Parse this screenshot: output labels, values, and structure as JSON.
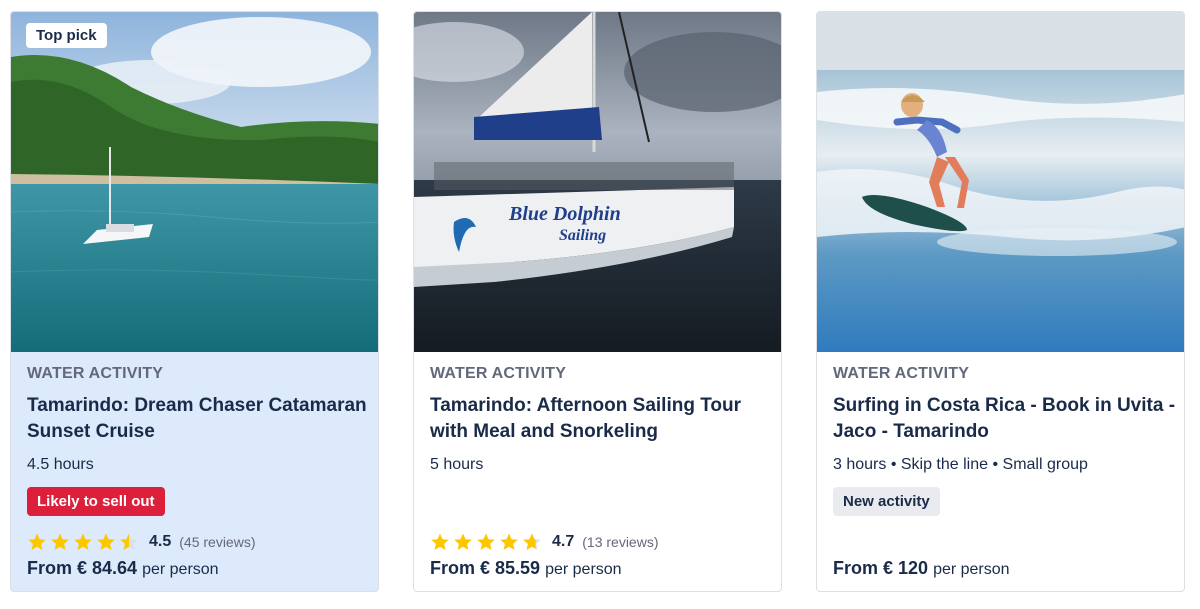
{
  "cards": [
    {
      "badge": "Top pick",
      "category": "WATER ACTIVITY",
      "title": "Tamarindo: Dream Chaser Catamaran Sunset Cruise",
      "meta": "4.5 hours",
      "tag": "Likely to sell out",
      "rating": 4.5,
      "rating_text": "4.5",
      "reviews": "(45 reviews)",
      "price": "From € 84.64",
      "price_unit": "per person"
    },
    {
      "category": "WATER ACTIVITY",
      "title": "Tamarindo: Afternoon Sailing Tour with Meal and Snorkeling",
      "meta": "5 hours",
      "boat_text_1": "Blue Dolphin",
      "boat_text_2": "Sailing",
      "rating": 4.7,
      "rating_text": "4.7",
      "reviews": "(13 reviews)",
      "price": "From € 85.59",
      "price_unit": "per person"
    },
    {
      "category": "WATER ACTIVITY",
      "title": "Surfing in Costa Rica - Book in Uvita - Jaco - Tamarindo",
      "meta": "3 hours • Skip the line • Small group",
      "tag": "New activity",
      "price": "From € 120",
      "price_unit": "per person"
    }
  ],
  "colors": {
    "star_fill": "#fdc700",
    "star_empty": "#dcdfe4",
    "sell_out_badge": "#dc1f3a",
    "highlight_card": "#dceafb",
    "text_primary": "#1a2b49",
    "text_secondary": "#63687a"
  }
}
